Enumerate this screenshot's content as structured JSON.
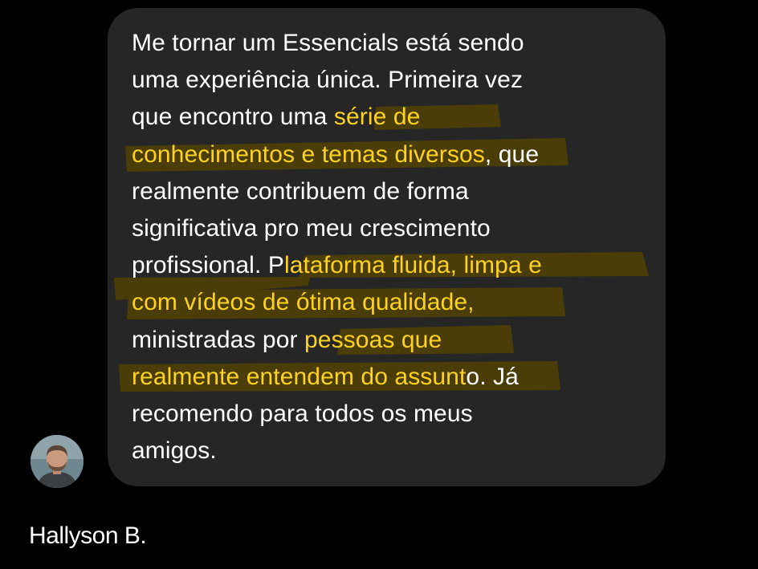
{
  "colors": {
    "background": "#000000",
    "bubble": "#262626",
    "text": "#ffffff",
    "highlight_text": "#ffd21f",
    "highlight_marker": "#4a3d08"
  },
  "message": {
    "lines": [
      [
        {
          "text": "Me tornar um Essencials está sendo",
          "hl": false
        }
      ],
      [
        {
          "text": "uma experiência única. Primeira vez",
          "hl": false
        }
      ],
      [
        {
          "text": "que encontro uma ",
          "hl": false
        },
        {
          "text": "série de",
          "hl": true
        }
      ],
      [
        {
          "text": "conhecimentos e temas diversos",
          "hl": true
        },
        {
          "text": ", que",
          "hl": false
        }
      ],
      [
        {
          "text": "realmente contribuem de forma",
          "hl": false
        }
      ],
      [
        {
          "text": "significativa pro meu crescimento",
          "hl": false
        }
      ],
      [
        {
          "text": "profissional. P",
          "hl": false
        },
        {
          "text": "lataforma fluida, limpa e",
          "hl": true
        }
      ],
      [
        {
          "text": "com vídeos de ótima qualidade,",
          "hl": true
        }
      ],
      [
        {
          "text": "ministradas por ",
          "hl": false
        },
        {
          "text": "pessoas que",
          "hl": true
        }
      ],
      [
        {
          "text": "realmente entendem do assunt",
          "hl": true
        },
        {
          "text": "o. Já",
          "hl": false
        }
      ],
      [
        {
          "text": "recomendo para todos os meus",
          "hl": false
        }
      ],
      [
        {
          "text": "amigos.",
          "hl": false
        }
      ]
    ]
  },
  "author": {
    "name": "Hallyson B.",
    "avatar_icon": "user-avatar-photo"
  }
}
